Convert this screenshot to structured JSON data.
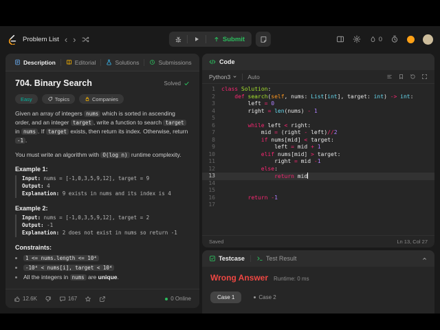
{
  "colors": {
    "accent_green": "#2cbb5d",
    "brand_orange": "#ffa116",
    "easy_teal": "#00b8a3",
    "error_red": "#ef4743",
    "premium_yellow": "#ffb800"
  },
  "navbar": {
    "problem_list_label": "Problem List",
    "submit_label": "Submit",
    "streak_count": "0"
  },
  "left_tabs": [
    {
      "label": "Description"
    },
    {
      "label": "Editorial"
    },
    {
      "label": "Solutions"
    },
    {
      "label": "Submissions"
    }
  ],
  "problem": {
    "title": "704. Binary Search",
    "solved_label": "Solved",
    "difficulty": "Easy",
    "topics_label": "Topics",
    "companies_label": "Companies",
    "paragraphs": [
      [
        {
          "k": "t",
          "v": "Given an array of integers "
        },
        {
          "k": "c",
          "v": "nums"
        },
        {
          "k": "t",
          "v": " which is sorted in ascending order, and an integer "
        },
        {
          "k": "c",
          "v": "target"
        },
        {
          "k": "t",
          "v": ", write a function to search "
        },
        {
          "k": "c",
          "v": "target"
        },
        {
          "k": "t",
          "v": " in "
        },
        {
          "k": "c",
          "v": "nums"
        },
        {
          "k": "t",
          "v": ". If "
        },
        {
          "k": "c",
          "v": "target"
        },
        {
          "k": "t",
          "v": " exists, then return its index. Otherwise, return "
        },
        {
          "k": "c",
          "v": "-1"
        },
        {
          "k": "t",
          "v": "."
        }
      ],
      [
        {
          "k": "t",
          "v": "You must write an algorithm with "
        },
        {
          "k": "c",
          "v": "O(log n)"
        },
        {
          "k": "t",
          "v": " runtime complexity."
        }
      ]
    ],
    "examples": [
      {
        "label": "Example 1:",
        "rows": [
          {
            "name": "Input:",
            "value": " nums = [-1,0,3,5,9,12], target = 9"
          },
          {
            "name": "Output:",
            "value": " 4"
          },
          {
            "name": "Explanation:",
            "value": " 9 exists in nums and its index is 4"
          }
        ]
      },
      {
        "label": "Example 2:",
        "rows": [
          {
            "name": "Input:",
            "value": " nums = [-1,0,3,5,9,12], target = 2"
          },
          {
            "name": "Output:",
            "value": " -1"
          },
          {
            "name": "Explanation:",
            "value": " 2 does not exist in nums so return -1"
          }
        ]
      }
    ],
    "constraints_label": "Constraints:",
    "constraints": [
      [
        {
          "k": "c",
          "v": "1 <= nums.length <= 10⁴"
        }
      ],
      [
        {
          "k": "c",
          "v": "-10⁴ < nums[i], target < 10⁴"
        }
      ],
      [
        {
          "k": "t",
          "v": "All the integers in "
        },
        {
          "k": "c",
          "v": "nums"
        },
        {
          "k": "t",
          "v": " are "
        },
        {
          "k": "b",
          "v": "unique"
        },
        {
          "k": "t",
          "v": "."
        }
      ]
    ],
    "footer": {
      "likes": "12.6K",
      "comments": "167",
      "online": "0 Online"
    }
  },
  "editor": {
    "panel_title": "Code",
    "language": "Python3",
    "autocomplete_label": "Auto",
    "saved_label": "Saved",
    "cursor_position": "Ln 13, Col 27",
    "lines": [
      {
        "n": "1",
        "tk": [
          [
            "k",
            "class"
          ],
          [
            "p",
            " "
          ],
          [
            "f",
            "Solution"
          ],
          [
            "p",
            ":"
          ]
        ]
      },
      {
        "n": "2",
        "tk": [
          [
            "p",
            "    "
          ],
          [
            "k",
            "def"
          ],
          [
            "p",
            " "
          ],
          [
            "f",
            "search"
          ],
          [
            "p",
            "("
          ],
          [
            "s",
            "self"
          ],
          [
            "p",
            ", nums: "
          ],
          [
            "t",
            "List"
          ],
          [
            "p",
            "["
          ],
          [
            "t",
            "int"
          ],
          [
            "p",
            "], target: "
          ],
          [
            "t",
            "int"
          ],
          [
            "p",
            ") "
          ],
          [
            "o",
            "->"
          ],
          [
            "p",
            " "
          ],
          [
            "t",
            "int"
          ],
          [
            "p",
            ":"
          ]
        ]
      },
      {
        "n": "3",
        "tk": [
          [
            "p",
            "        left "
          ],
          [
            "o",
            "="
          ],
          [
            "p",
            " "
          ],
          [
            "n",
            "0"
          ]
        ]
      },
      {
        "n": "4",
        "tk": [
          [
            "p",
            "        right "
          ],
          [
            "o",
            "="
          ],
          [
            "p",
            " "
          ],
          [
            "t",
            "len"
          ],
          [
            "p",
            "(nums) "
          ],
          [
            "o",
            "-"
          ],
          [
            "p",
            " "
          ],
          [
            "n",
            "1"
          ]
        ]
      },
      {
        "n": "5",
        "tk": []
      },
      {
        "n": "6",
        "tk": [
          [
            "p",
            "        "
          ],
          [
            "k",
            "while"
          ],
          [
            "p",
            " left "
          ],
          [
            "o",
            "<"
          ],
          [
            "p",
            " right:"
          ]
        ]
      },
      {
        "n": "7",
        "tk": [
          [
            "p",
            "            mid "
          ],
          [
            "o",
            "="
          ],
          [
            "p",
            " (right "
          ],
          [
            "o",
            "-"
          ],
          [
            "p",
            " left)"
          ],
          [
            "o",
            "//"
          ],
          [
            "n",
            "2"
          ]
        ]
      },
      {
        "n": "8",
        "tk": [
          [
            "p",
            "            "
          ],
          [
            "k",
            "if"
          ],
          [
            "p",
            " nums[mid] "
          ],
          [
            "o",
            "<"
          ],
          [
            "p",
            " target:"
          ]
        ]
      },
      {
        "n": "9",
        "tk": [
          [
            "p",
            "                left "
          ],
          [
            "o",
            "="
          ],
          [
            "p",
            " mid "
          ],
          [
            "o",
            "+"
          ],
          [
            "p",
            " "
          ],
          [
            "n",
            "1"
          ]
        ]
      },
      {
        "n": "10",
        "tk": [
          [
            "p",
            "            "
          ],
          [
            "k",
            "elif"
          ],
          [
            "p",
            " nums[mid] "
          ],
          [
            "o",
            ">"
          ],
          [
            "p",
            " target:"
          ]
        ]
      },
      {
        "n": "11",
        "tk": [
          [
            "p",
            "                right "
          ],
          [
            "o",
            "="
          ],
          [
            "p",
            " mid "
          ],
          [
            "o",
            "-"
          ],
          [
            "n",
            "1"
          ]
        ]
      },
      {
        "n": "12",
        "tk": [
          [
            "p",
            "            "
          ],
          [
            "k",
            "else"
          ],
          [
            "p",
            ":"
          ]
        ]
      },
      {
        "n": "13",
        "tk": [
          [
            "p",
            "                "
          ],
          [
            "k",
            "return"
          ],
          [
            "p",
            " mid"
          ]
        ],
        "hl": true,
        "cursor": true
      },
      {
        "n": "14",
        "tk": []
      },
      {
        "n": "15",
        "tk": []
      },
      {
        "n": "16",
        "tk": [
          [
            "p",
            "        "
          ],
          [
            "k",
            "return"
          ],
          [
            "p",
            " "
          ],
          [
            "o",
            "-"
          ],
          [
            "n",
            "1"
          ]
        ]
      },
      {
        "n": "17",
        "tk": []
      }
    ]
  },
  "testcase": {
    "testcase_tab": "Testcase",
    "result_tab": "Test Result",
    "verdict": "Wrong Answer",
    "runtime": "Runtime: 0 ms",
    "cases": [
      "Case 1",
      "Case 2"
    ]
  }
}
